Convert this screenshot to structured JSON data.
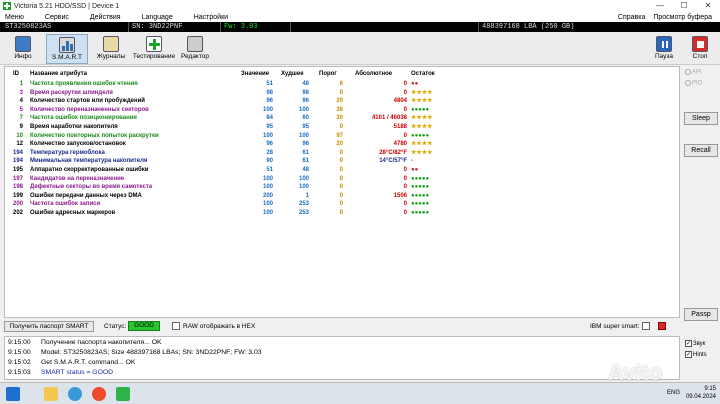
{
  "window": {
    "title": "Victoria 5.21 HDD/SSD | Device 1",
    "minimize": "—",
    "maximize": "☐",
    "close": "✕"
  },
  "menu": {
    "items": [
      "Меню",
      "Сервис",
      "Действия",
      "Language",
      "Настройки"
    ],
    "help": "Справка",
    "viewer": "Просмотр буфера"
  },
  "device": {
    "model": "ST3250823AS",
    "sn": "SN: 3ND22PNF",
    "fw": "Fw: 3.03",
    "lba": "488397168 LBA (250 GB)"
  },
  "toolbar": {
    "info": "Инфо",
    "smart": "S.M.A.R.T",
    "logs": "Журналы",
    "test": "Тестирование",
    "editor": "Редактор",
    "pause": "Пауза",
    "stop": "Стоп"
  },
  "table": {
    "headers": {
      "id": "ID",
      "name": "Название атрибута",
      "value": "Значение",
      "worst": "Худшее",
      "threshold": "Порог",
      "raw": "Абсолютное",
      "remark": "Остаток"
    },
    "rows": [
      {
        "id": "1",
        "name": "Частота проявления ошибок чтения",
        "value": "51",
        "worst": "48",
        "threshold": "6",
        "raw": "0",
        "remark": "●●",
        "nc": "n-green",
        "vc": "v-blue",
        "tc": "v-orange",
        "rc": "r-red",
        "sc": "s-red"
      },
      {
        "id": "3",
        "name": "Время раскрутки шпинделя",
        "value": "98",
        "worst": "98",
        "threshold": "0",
        "raw": "0",
        "remark": "★★★★",
        "nc": "n-purple",
        "vc": "v-blue",
        "tc": "v-orange",
        "rc": "r-red",
        "sc": "s-yellow"
      },
      {
        "id": "4",
        "name": "Количество стартов или пробуждений",
        "value": "96",
        "worst": "96",
        "threshold": "20",
        "raw": "4804",
        "remark": "★★★★",
        "nc": "n-black",
        "vc": "v-blue",
        "tc": "v-orange",
        "rc": "r-red",
        "sc": "s-yellow"
      },
      {
        "id": "5",
        "name": "Количество переназначенных секторов",
        "value": "100",
        "worst": "100",
        "threshold": "36",
        "raw": "0",
        "remark": "●●●●●",
        "nc": "n-purple",
        "vc": "v-blue",
        "tc": "v-orange",
        "rc": "r-red",
        "sc": "s-green"
      },
      {
        "id": "7",
        "name": "Частота ошибок позиционирования",
        "value": "84",
        "worst": "60",
        "threshold": "30",
        "raw": "4101 / 46038",
        "remark": "★★★★",
        "nc": "n-green",
        "vc": "v-blue",
        "tc": "v-orange",
        "rc": "r-red",
        "sc": "s-yellow"
      },
      {
        "id": "9",
        "name": "Время наработки накопителя",
        "value": "95",
        "worst": "95",
        "threshold": "0",
        "raw": "5188",
        "remark": "★★★★",
        "nc": "n-black",
        "vc": "v-blue",
        "tc": "v-orange",
        "rc": "r-red",
        "sc": "s-yellow"
      },
      {
        "id": "10",
        "name": "Количество повторных попыток раскрутки",
        "value": "100",
        "worst": "100",
        "threshold": "97",
        "raw": "0",
        "remark": "●●●●●",
        "nc": "n-green",
        "vc": "v-blue",
        "tc": "v-orange",
        "rc": "r-red",
        "sc": "s-green"
      },
      {
        "id": "12",
        "name": "Количество запусков/остановок",
        "value": "96",
        "worst": "96",
        "threshold": "20",
        "raw": "4780",
        "remark": "★★★★",
        "nc": "n-black",
        "vc": "v-blue",
        "tc": "v-orange",
        "rc": "r-red",
        "sc": "s-yellow"
      },
      {
        "id": "194",
        "name": "Температура гермоблока",
        "value": "28",
        "worst": "61",
        "threshold": "0",
        "raw": "28°C/82°F",
        "remark": "★★★★",
        "nc": "n-blue",
        "vc": "v-blue",
        "tc": "v-orange",
        "rc": "r-red",
        "sc": "s-yellow"
      },
      {
        "id": "194",
        "name": "Минимальная температура накопителя",
        "value": "90",
        "worst": "61",
        "threshold": "0",
        "raw": "14°C/57°F",
        "remark": "-",
        "nc": "n-blue",
        "vc": "v-blue",
        "tc": "v-orange",
        "rc": "r-blue",
        "sc": "s-red"
      },
      {
        "id": "195",
        "name": "Аппаратно скорректированные ошибки",
        "value": "51",
        "worst": "48",
        "threshold": "0",
        "raw": "0",
        "remark": "●●",
        "nc": "n-black",
        "vc": "v-blue",
        "tc": "v-orange",
        "rc": "r-red",
        "sc": "s-red"
      },
      {
        "id": "197",
        "name": "Кандидатов на переназначение",
        "value": "100",
        "worst": "100",
        "threshold": "0",
        "raw": "0",
        "remark": "●●●●●",
        "nc": "n-purple",
        "vc": "v-blue",
        "tc": "v-orange",
        "rc": "r-red",
        "sc": "s-green"
      },
      {
        "id": "198",
        "name": "Дефектные секторы во время самотеста",
        "value": "100",
        "worst": "100",
        "threshold": "0",
        "raw": "0",
        "remark": "●●●●●",
        "nc": "n-purple",
        "vc": "v-blue",
        "tc": "v-orange",
        "rc": "r-red",
        "sc": "s-green"
      },
      {
        "id": "199",
        "name": "Ошибки передачи данных через DMA",
        "value": "200",
        "worst": "1",
        "threshold": "0",
        "raw": "1506",
        "remark": "●●●●●",
        "nc": "n-black",
        "vc": "v-blue",
        "tc": "v-orange",
        "rc": "r-red",
        "sc": "s-green"
      },
      {
        "id": "200",
        "name": "Частота ошибок записи",
        "value": "100",
        "worst": "253",
        "threshold": "0",
        "raw": "0",
        "remark": "●●●●●",
        "nc": "n-purple",
        "vc": "v-blue",
        "tc": "v-orange",
        "rc": "r-red",
        "sc": "s-green"
      },
      {
        "id": "202",
        "name": "Ошибки адресных маркеров",
        "value": "100",
        "worst": "253",
        "threshold": "0",
        "raw": "0",
        "remark": "●●●●●",
        "nc": "n-black",
        "vc": "v-blue",
        "tc": "v-orange",
        "rc": "r-red",
        "sc": "s-green"
      }
    ]
  },
  "side": {
    "api": "API",
    "pio": "PIO",
    "sleep": "Sleep",
    "recall": "Recall",
    "passp": "Passp"
  },
  "status": {
    "get_smart": "Получить паспорт SMART",
    "status_label": "Статус:",
    "status_value": "GOOD",
    "raw_hex": "RAW отображать в HEX",
    "ibm": "IBM super smart:"
  },
  "log": [
    {
      "time": "9:15:00",
      "msg": "Получение паспорта накопителя... OK"
    },
    {
      "time": "9:15:00",
      "msg": "Model: ST3250823AS; Size 488397168 LBAs; SN: 3ND22PNF; FW: 3.03"
    },
    {
      "time": "9:15:02",
      "msg": "Get S.M.A.R.T. command... OK"
    },
    {
      "time": "9:15:03",
      "msg": "SMART status = GOOD"
    }
  ],
  "log_options": {
    "sound": "Звук",
    "hints": "Hints"
  },
  "tray": {
    "lang": "ENG",
    "time": "9:15",
    "date": "09.04.2024"
  },
  "watermark": "Avito"
}
